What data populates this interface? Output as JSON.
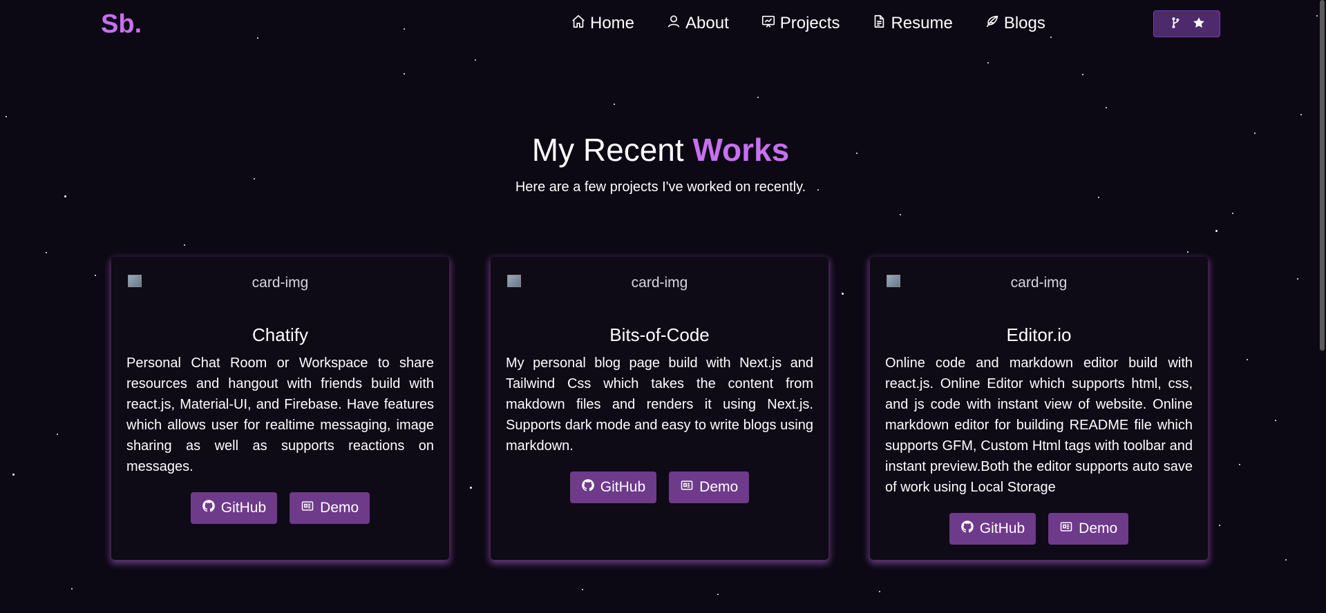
{
  "brand": {
    "logo_text": "Sb",
    "logo_dot": "."
  },
  "nav": {
    "items": [
      {
        "label": "Home",
        "icon": "home-icon"
      },
      {
        "label": "About",
        "icon": "user-icon"
      },
      {
        "label": "Projects",
        "icon": "presentation-icon"
      },
      {
        "label": "Resume",
        "icon": "document-icon"
      },
      {
        "label": "Blogs",
        "icon": "feather-icon"
      }
    ],
    "cta_icons": [
      "git-fork-icon",
      "star-icon"
    ]
  },
  "section": {
    "title_plain": "My Recent ",
    "title_accent": "Works",
    "subtitle": "Here are a few projects I've worked on recently."
  },
  "cards": [
    {
      "img_alt": "card-img",
      "title": "Chatify",
      "description": "Personal Chat Room or Workspace to share resources and hangout with friends build with react.js, Material-UI, and Firebase. Have features which allows user for realtime messaging, image sharing as well as supports reactions on messages.",
      "github_label": "GitHub",
      "demo_label": "Demo"
    },
    {
      "img_alt": "card-img",
      "title": "Bits-of-Code",
      "description": "My personal blog page build with Next.js and Tailwind Css which takes the content from makdown files and renders it using Next.js. Supports dark mode and easy to write blogs using markdown.",
      "github_label": "GitHub",
      "demo_label": "Demo"
    },
    {
      "img_alt": "card-img",
      "title": "Editor.io",
      "description": "Online code and markdown editor build with react.js. Online Editor which supports html, css, and js code with instant view of website. Online markdown editor for building README file which supports GFM, Custom Html tags with toolbar and instant preview.Both the editor supports auto save of work using Local Storage",
      "github_label": "GitHub",
      "demo_label": "Demo"
    }
  ],
  "colors": {
    "background": "#0c0814",
    "accent": "#c770f0",
    "button": "#6e3a8a",
    "card_glow": "#c770f0"
  }
}
